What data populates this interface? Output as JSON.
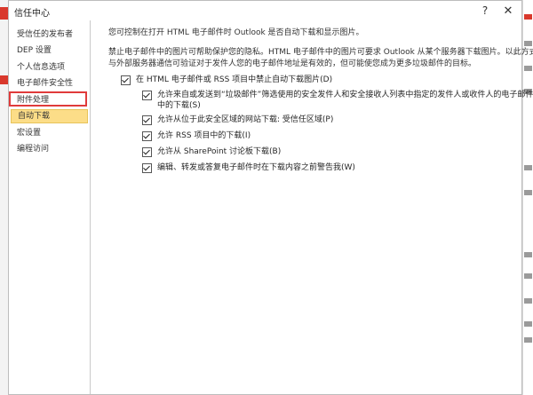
{
  "dialog": {
    "title": "信任中心",
    "help_glyph": "?",
    "close_glyph": "✕"
  },
  "sidebar": {
    "items": [
      {
        "label": "受信任的发布者"
      },
      {
        "label": "DEP 设置"
      },
      {
        "label": "个人信息选项"
      },
      {
        "label": "电子邮件安全性"
      },
      {
        "label": "附件处理"
      },
      {
        "label": "自动下载"
      },
      {
        "label": "宏设置"
      },
      {
        "label": "编程访问"
      }
    ],
    "active_item": "自动下载"
  },
  "main": {
    "intro": "您可控制在打开 HTML 电子邮件时 Outlook 是否自动下载和显示图片。",
    "privacy_line1": "禁止电子邮件中的图片可帮助保护您的隐私。HTML 电子邮件中的图片可要求 Outlook 从某个服务器下载图片。以此方式",
    "privacy_line2": "与外部服务器通信可验证对于发件人您的电子邮件地址是有效的，但可能使您成为更多垃圾邮件的目标。",
    "master_option": {
      "label": "在 HTML 电子邮件或 RSS 项目中禁止自动下载图片(D)",
      "checked": true
    },
    "sub_options": [
      {
        "label": "允许来自或发送到“垃圾邮件”筛选使用的安全发件人和安全接收人列表中指定的发件人或收件人的电子邮件中的下载(S)",
        "checked": true
      },
      {
        "label": "允许从位于此安全区域的网站下载: 受信任区域(P)",
        "checked": true
      },
      {
        "label": "允许 RSS 项目中的下载(I)",
        "checked": true
      },
      {
        "label": "允许从 SharePoint 讨论板下载(B)",
        "checked": true
      },
      {
        "label": "编辑、转发或答复电子邮件时在下载内容之前警告我(W)",
        "checked": true
      }
    ]
  }
}
